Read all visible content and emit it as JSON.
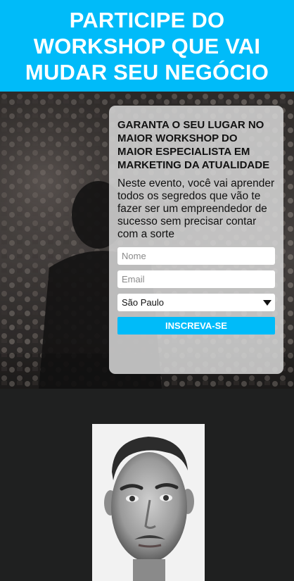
{
  "banner": {
    "title": "PARTICIPE DO WORKSHOP QUE VAI MUDAR SEU NEGÓCIO",
    "background": "#00bbf9"
  },
  "hero": {
    "image": "conference-crowd-photo"
  },
  "form": {
    "heading": "GARANTA O SEU LUGAR NO MAIOR WORKSHOP DO MAIOR ESPECIALISTA EM MARKETING DA ATUALIDADE",
    "description": "Neste evento, você vai aprender todos os segredos que vão te fazer ser um empreendedor de sucesso sem precisar contar com a sorte",
    "name_placeholder": "Nome",
    "email_placeholder": "Email",
    "city_selected": "São Paulo",
    "submit_label": "INSCREVA-SE",
    "accent": "#00bbf9"
  },
  "speaker": {
    "image": "speaker-portrait-photo"
  }
}
